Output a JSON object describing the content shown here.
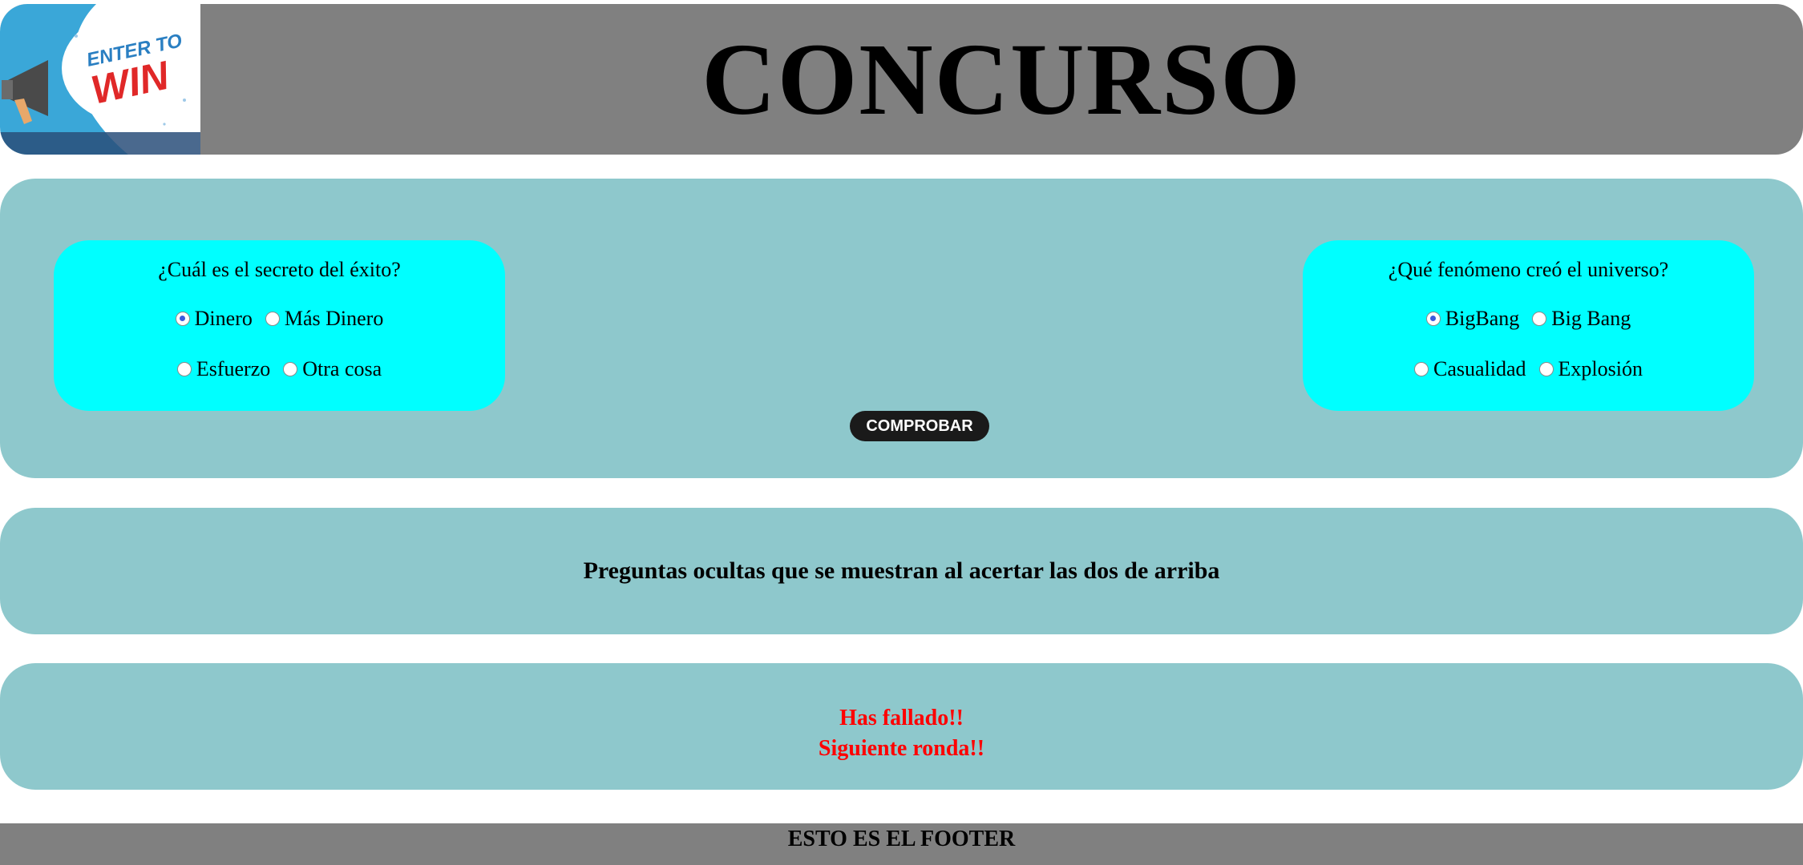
{
  "header": {
    "title": "CONCURSO",
    "logo_line1": "ENTER TO",
    "logo_line2": "WIN"
  },
  "quiz": {
    "question1": {
      "text": "¿Cuál es el secreto del éxito?",
      "options": [
        "Dinero",
        "Más Dinero",
        "Esfuerzo",
        "Otra cosa"
      ],
      "selected": "Dinero"
    },
    "question2": {
      "text": "¿Qué fenómeno creó el universo?",
      "options": [
        "BigBang",
        "Big Bang",
        "Casualidad",
        "Explosión"
      ],
      "selected": "BigBang"
    },
    "check_button_label": "COMPROBAR"
  },
  "hidden_section": {
    "text": "Preguntas ocultas que se muestran al acertar las dos de arriba"
  },
  "result": {
    "line1": "Has fallado!!",
    "line2": "Siguiente ronda!!"
  },
  "footer": {
    "text": "ESTO ES EL FOOTER"
  },
  "colors": {
    "header_bg": "#808080",
    "panel_bg": "#8ec8cc",
    "card_bg": "#00ffff",
    "button_bg": "#1a1a1a",
    "result_text": "#ff0000",
    "footer_bg": "#808080"
  }
}
